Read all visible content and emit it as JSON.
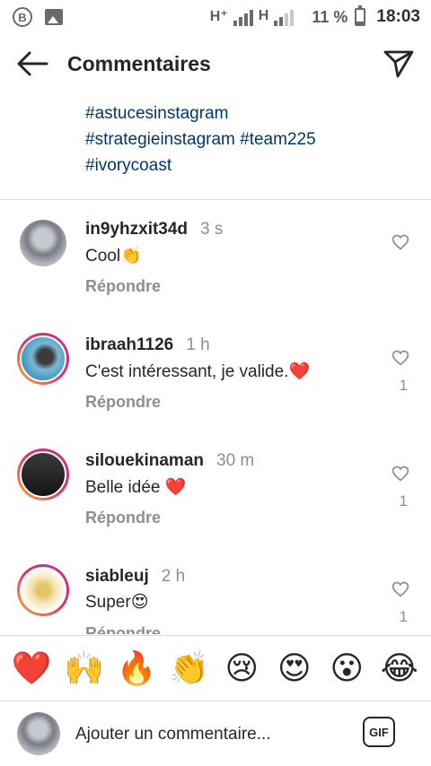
{
  "status_bar": {
    "network": "H⁺",
    "network2": "H",
    "battery": "11 %",
    "time": "18:03",
    "icons": [
      "b-circle-icon",
      "image-icon",
      "signal-icon",
      "battery-icon"
    ]
  },
  "header": {
    "title": "Commentaires",
    "back_icon": "arrow-left-icon",
    "send_icon": "send-icon"
  },
  "caption": {
    "lines": [
      "#astucesinstagram",
      "#strategieinstagram #team225",
      "#ivorycoast"
    ]
  },
  "comments": [
    {
      "username": "in9yhzxit34d",
      "time": "3 s",
      "text": "Cool",
      "emoji": "👏",
      "reply": "Répondre",
      "likes": ""
    },
    {
      "username": "ibraah1126",
      "time": "1 h",
      "text": "C'est intéressant, je valide.",
      "emoji": "❤️",
      "reply": "Répondre",
      "likes": "1"
    },
    {
      "username": "silouekinaman",
      "time": "30 m",
      "text": "Belle idée ",
      "emoji": "❤️",
      "reply": "Répondre",
      "likes": "1"
    },
    {
      "username": "siableuj",
      "time": "2 h",
      "text": "Super",
      "emoji": "😍",
      "reply": "Répondre",
      "likes": "1"
    }
  ],
  "emoji_bar": [
    "❤️",
    "🙌",
    "🔥",
    "👏",
    "😢",
    "😍",
    "😮",
    "😂"
  ],
  "composer": {
    "placeholder": "Ajouter un commentaire...",
    "gif_label": "GIF"
  },
  "colors": {
    "hashtag": "#00376b",
    "secondary_text": "#8e8e8e",
    "divider": "#dbdbdb"
  }
}
